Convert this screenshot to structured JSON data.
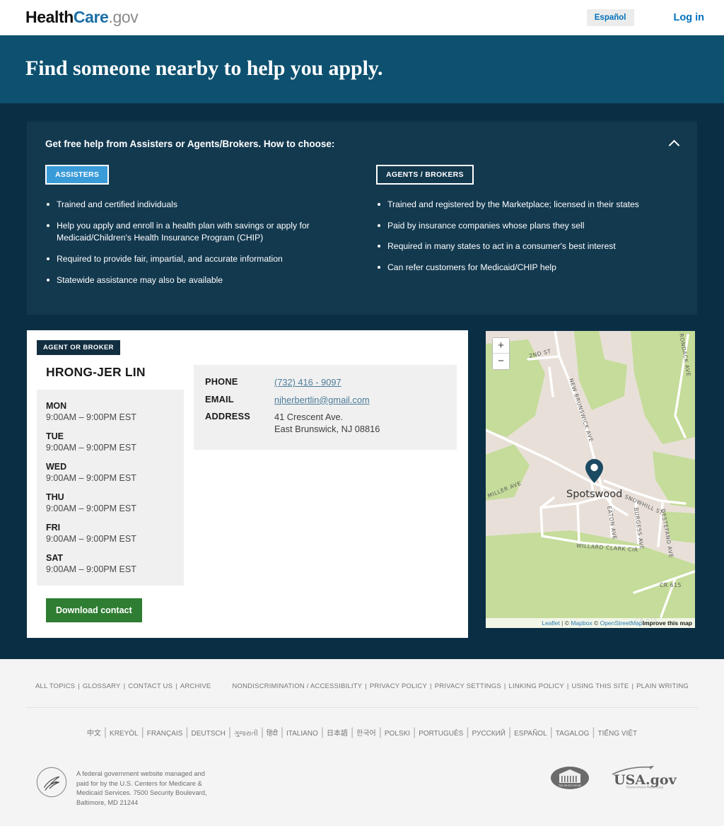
{
  "header": {
    "logo": {
      "part1": "Health",
      "part2": "Care",
      "part3": ".gov"
    },
    "espanol_label": "Español",
    "login_label": "Log in"
  },
  "hero": {
    "title": "Find someone nearby to help you apply."
  },
  "info_panel": {
    "title": "Get free help from Assisters or Agents/Brokers. How to choose:",
    "collapse_icon": "chevron-up-icon",
    "tabs": [
      {
        "label": "ASSISTERS",
        "active": true,
        "bullets": [
          "Trained and certified individuals",
          "Help you apply and enroll in a health plan with savings or apply for Medicaid/Children's Health Insurance Program (CHIP)",
          "Required to provide fair, impartial, and accurate information",
          "Statewide assistance may also be available"
        ]
      },
      {
        "label": "AGENTS / BROKERS",
        "active": false,
        "bullets": [
          "Trained and registered by the Marketplace; licensed in their states",
          "Paid by insurance companies whose plans they sell",
          "Required in many states to act in a consumer's best interest",
          "Can refer customers for Medicaid/CHIP help"
        ]
      }
    ]
  },
  "contact_card": {
    "badge": "AGENT OR BROKER",
    "name": "HRONG-JER LIN",
    "hours": [
      {
        "day": "MON",
        "time": "9:00AM – 9:00PM EST"
      },
      {
        "day": "TUE",
        "time": "9:00AM – 9:00PM EST"
      },
      {
        "day": "WED",
        "time": "9:00AM – 9:00PM EST"
      },
      {
        "day": "THU",
        "time": "9:00AM – 9:00PM EST"
      },
      {
        "day": "FRI",
        "time": "9:00AM – 9:00PM EST"
      },
      {
        "day": "SAT",
        "time": "9:00AM – 9:00PM EST"
      }
    ],
    "download_label": "Download contact",
    "details": {
      "phone_label": "PHONE",
      "phone_value": "(732) 416 - 9097",
      "email_label": "EMAIL",
      "email_value": "njherbertlin@gmail.com",
      "address_label": "ADDRESS",
      "address_line1": "41 Crescent Ave.",
      "address_line2": "East Brunswick, NJ 08816"
    }
  },
  "map": {
    "zoom_in_label": "+",
    "zoom_out_label": "−",
    "city_label": "Spotswood",
    "marker_icon": "map-pin-icon",
    "streets": [
      "2ND ST",
      "NEW BRUNSWICK AVE",
      "RONDACK AVE",
      "MILLER AVE",
      "SNOWHILL ST",
      "EATON AVE",
      "BURGESS AVE",
      "DESTEFANO AVE",
      "WILLARD CLARK CIR",
      "CR 615",
      "CR 615"
    ],
    "attribution": {
      "leaflet": "Leaflet",
      "mapbox": "Mapbox",
      "osm": "OpenStreetMap",
      "improve": "Improve this map"
    },
    "colors": {
      "land": "#e8e0d8",
      "park": "#c5dc9a",
      "road": "#ffffff",
      "marker": "#1b4a63"
    }
  },
  "footer": {
    "left_links": [
      "ALL TOPICS",
      "GLOSSARY",
      "CONTACT US",
      "ARCHIVE"
    ],
    "right_links": [
      "NONDISCRIMINATION / ACCESSIBILITY",
      "PRIVACY POLICY",
      "PRIVACY SETTINGS",
      "LINKING POLICY",
      "USING THIS SITE",
      "PLAIN WRITING"
    ],
    "languages": [
      "中文",
      "KREYÒL",
      "FRANÇAIS",
      "DEUTSCH",
      "ગુજરાતી",
      "हिंदी",
      "ITALIANO",
      "日本語",
      "한국어",
      "POLSKI",
      "PORTUGUÊS",
      "РУССКИЙ",
      "ESPAÑOL",
      "TAGALOG",
      "TIẾNG VIỆT"
    ],
    "agency_text": "A federal government website managed and paid for by the U.S. Centers for Medicare & Medicaid Services. 7500 Security Boulevard, Baltimore, MD 21244",
    "hhs_icon": "hhs-seal-icon",
    "whitehouse_icon": "white-house-logo",
    "whitehouse_text": "THE WHITE HOUSE",
    "usagov_icon": "usagov-logo",
    "usagov_text": "USA.gov",
    "usagov_tagline": "Government Made Easy"
  },
  "theme": {
    "hero_bg": "#0d506f",
    "main_bg": "#0a2f45",
    "panel_bg": "#13394f",
    "accent_blue": "#3a9bd9",
    "link_blue": "#0071bc",
    "green": "#2e7d32"
  }
}
